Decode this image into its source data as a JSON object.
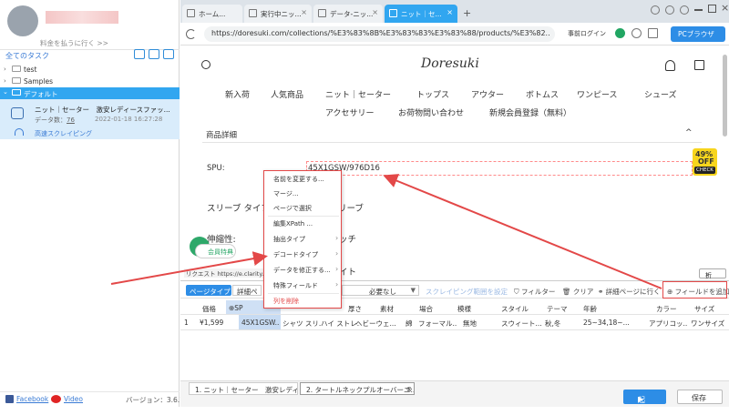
{
  "sidebar": {
    "upgrade_link": "料金を払うに行く >>",
    "all_tasks": "全てのタスク",
    "tree": [
      {
        "label": "test"
      },
      {
        "label": "Samples"
      },
      {
        "label": "デフォルト"
      }
    ],
    "task": {
      "name": "ニット｜セーター　激安レディースファッ...",
      "count_label": "データ数：",
      "count": "76",
      "time": "2022-01-18 16:27:28",
      "mode": "高速スクレイピング"
    },
    "footer": {
      "facebook": "Facebook",
      "video": "Video",
      "version": "バージョン：3.6.1"
    }
  },
  "browser": {
    "tabs": [
      {
        "label": "ホーム..."
      },
      {
        "label": "実行中ニッ..."
      },
      {
        "label": "データ-ニッ..."
      },
      {
        "label": "ニット｜セ..."
      }
    ],
    "tab_add": "+",
    "url": "https://doresuki.com/collections/%E3%83%8B%E3%83%83%E3%83%88/products/%E3%82...",
    "login_label": "事前ログイン",
    "pc_browser": "PCブラウザ"
  },
  "site": {
    "logo": "Doresuki",
    "nav_row1": [
      "新入荷",
      "人気商品",
      "ニット｜セーター",
      "トップス",
      "アウター",
      "ボトムス",
      "ワンピース",
      "シューズ"
    ],
    "nav_row2": [
      "アクセサリー",
      "お荷物問い合わせ",
      "新規会員登録（無料）"
    ],
    "detail_title": "商品詳細",
    "spu_label": "SPU:",
    "spu_value": "45X1GSW/976D16",
    "sleeve_label": "スリーブ タイプ",
    "sleeve_value": "リーブ",
    "material_label": "伸縮性:",
    "stretch_value": "ッチ",
    "seito_value": "イト",
    "member_badge": "会員特典",
    "promo": {
      "pct": "49%",
      "off": "OFF",
      "check": "CHECK"
    },
    "request_url": "リクエスト https://e.clarity.m",
    "fold": "折る"
  },
  "context_menu": {
    "items": [
      {
        "label": "名前を変更する...",
        "submenu": false,
        "danger": false
      },
      {
        "label": "マージ...",
        "submenu": false,
        "danger": false
      },
      {
        "label": "ページで選択",
        "submenu": false,
        "danger": false
      },
      {
        "label": "編集XPath ...",
        "submenu": false,
        "danger": false
      },
      {
        "label": "抽出タイプ",
        "submenu": true,
        "danger": false
      },
      {
        "label": "デコードタイプ",
        "submenu": true,
        "danger": false
      },
      {
        "label": "データを修正する...",
        "submenu": true,
        "danger": false
      },
      {
        "label": "特殊フィールド",
        "submenu": true,
        "danger": false
      },
      {
        "label": "列を削除",
        "submenu": false,
        "danger": true
      }
    ]
  },
  "toolbar": {
    "page_type": "ページタイプ",
    "page_type_value": "詳細ペ",
    "need_label": "必要なし",
    "scroll_range": "スクレイピング範囲を設定",
    "filter": "フィルター",
    "clear": "クリア",
    "goto_detail": "詳細ページに行く",
    "add_field": "フィールドを追加"
  },
  "table": {
    "headers": [
      "価格",
      "SP",
      "",
      "",
      "厚さ",
      "素材",
      "場合",
      "模様",
      "スタイル",
      "テーマ",
      "年齢",
      "カラー",
      "サイズ"
    ],
    "rows": [
      [
        "1",
        "¥1,599",
        "45X1GSW...",
        "シャツ スリ...",
        "ハイ ストレ...",
        "ヘビーウェ...",
        "綿",
        "フォーマル...",
        "無地",
        "スウィート...",
        "秋,冬",
        "25~34,18~...",
        "アプリコッ...",
        "ワンサイズ"
      ]
    ]
  },
  "bottom": {
    "tabs": [
      "1. ニット｜セーター　激安レディ...",
      "2. タートルネックプルオーバーニ..."
    ],
    "start": "起動",
    "save": "保存"
  },
  "colors": {
    "accent": "#31a6f0",
    "button": "#2d8de6",
    "highlight": "#e34848"
  }
}
